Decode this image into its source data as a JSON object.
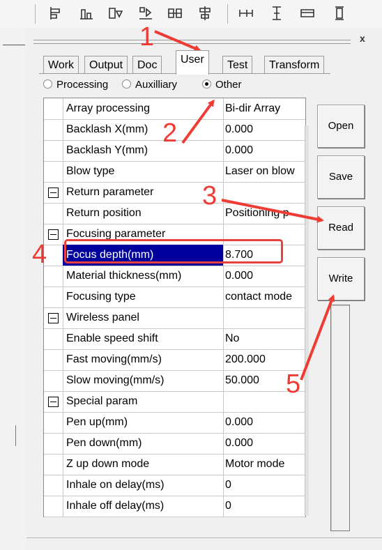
{
  "toolbar": {
    "icons": [
      "align-left-icon",
      "align-bottom-icon",
      "align-center-v-icon",
      "align-center-h-icon",
      "align-center-both-icon",
      "align-middle-icon",
      "same-width-icon",
      "same-height-icon",
      "same-size-icon",
      "equal-spacing-icon"
    ]
  },
  "panel": {
    "close_label": "x"
  },
  "tabs": [
    {
      "label": "Work"
    },
    {
      "label": "Output"
    },
    {
      "label": "Doc"
    },
    {
      "label": "User",
      "active": true
    },
    {
      "label": "Test"
    },
    {
      "label": "Transform"
    }
  ],
  "radios": [
    {
      "label": "Processing",
      "checked": false
    },
    {
      "label": "Auxilliary",
      "checked": false
    },
    {
      "label": "Other",
      "checked": true
    }
  ],
  "grid": {
    "rows": [
      {
        "name": "Array processing",
        "value": "Bi-dir Array"
      },
      {
        "name": "Backlash X(mm)",
        "value": "0.000"
      },
      {
        "name": "Backlash Y(mm)",
        "value": "0.000"
      },
      {
        "name": "Blow type",
        "value": "Laser on blow"
      },
      {
        "name": "Return parameter",
        "value": "",
        "group": true
      },
      {
        "name": "Return position",
        "value": "Positioning p"
      },
      {
        "name": "Focusing parameter",
        "value": "",
        "group": true
      },
      {
        "name": "Focus depth(mm)",
        "value": "8.700",
        "selected": true
      },
      {
        "name": "Material thickness(mm)",
        "value": "0.000"
      },
      {
        "name": "Focusing type",
        "value": "contact mode"
      },
      {
        "name": "Wireless panel",
        "value": "",
        "group": true
      },
      {
        "name": "Enable speed shift",
        "value": "No"
      },
      {
        "name": "Fast moving(mm/s)",
        "value": "200.000"
      },
      {
        "name": "Slow moving(mm/s)",
        "value": "50.000"
      },
      {
        "name": "Special param",
        "value": "",
        "group": true
      },
      {
        "name": "Pen up(mm)",
        "value": "0.000"
      },
      {
        "name": "Pen down(mm)",
        "value": "0.000"
      },
      {
        "name": "Z up down mode",
        "value": "Motor mode"
      },
      {
        "name": "Inhale on delay(ms)",
        "value": "0"
      },
      {
        "name": "Inhale off delay(ms)",
        "value": "0"
      }
    ]
  },
  "buttons": {
    "open": "Open",
    "save": "Save",
    "read": "Read",
    "write": "Write"
  },
  "annotations": {
    "color": "#ee3c35",
    "steps": [
      "1",
      "2",
      "3",
      "4",
      "5"
    ]
  }
}
